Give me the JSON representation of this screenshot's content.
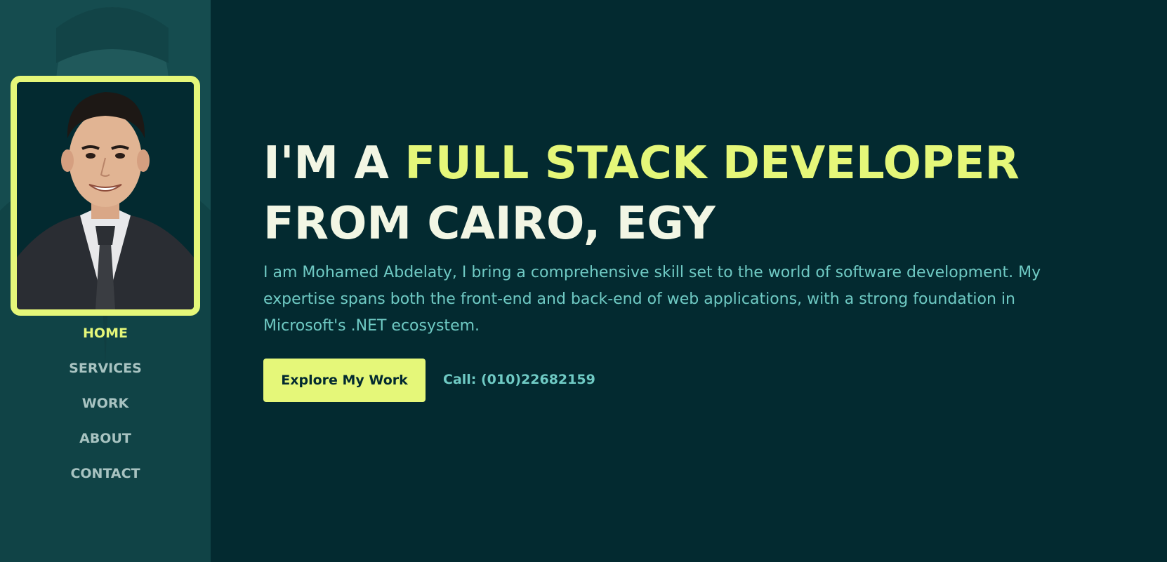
{
  "sidebar": {
    "portrait_alt": "Mohamed Abdelaty",
    "nav": [
      {
        "label": "HOME",
        "active": true
      },
      {
        "label": "SERVICES",
        "active": false
      },
      {
        "label": "WORK",
        "active": false
      },
      {
        "label": "ABOUT",
        "active": false
      },
      {
        "label": "CONTACT",
        "active": false
      }
    ]
  },
  "hero": {
    "headline_prefix": "I'M A ",
    "headline_accent": "FULL STACK DEVELOPER",
    "headline_line2": "FROM CAIRO, EGY",
    "intro": "I am Mohamed Abdelaty, I bring a comprehensive skill set to the world of software development. My expertise spans both the front-end and back-end of web applications, with a strong foundation in Microsoft's .NET ecosystem.",
    "cta_label": "Explore My Work",
    "call_text": "Call: (010)22682159"
  },
  "colors": {
    "background": "#032a30",
    "sidebar": "#154c4f",
    "accent": "#e5f779",
    "text_light": "#f2f6e4",
    "text_teal": "#6fcac4",
    "nav_inactive": "#a8c3c1"
  },
  "icons": [
    "portrait-photo"
  ]
}
